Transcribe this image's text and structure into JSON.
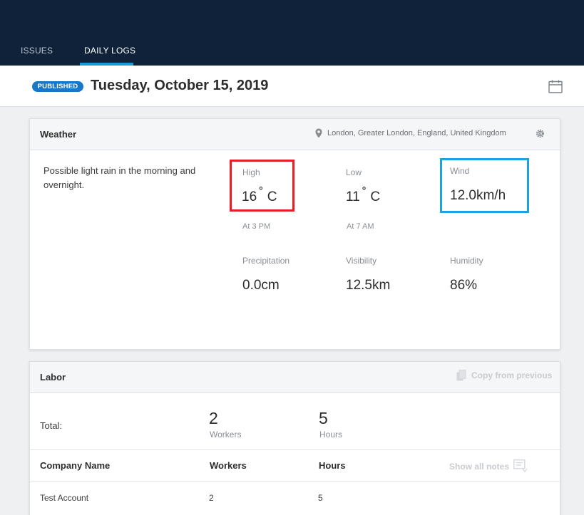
{
  "nav": {
    "tabs": [
      {
        "label": "ISSUES",
        "active": false
      },
      {
        "label": "DAILY LOGS",
        "active": true
      }
    ]
  },
  "header": {
    "status_badge": "PUBLISHED",
    "date": "Tuesday, October 15, 2019",
    "calendar_icon": "calendar-icon"
  },
  "weather": {
    "title": "Weather",
    "location": "London, Greater London, England, United Kingdom",
    "summary": "Possible light rain in the morning and overnight.",
    "high": {
      "label": "High",
      "value": "16",
      "degree": "°",
      "unit": "C",
      "time": "At 3 PM"
    },
    "low": {
      "label": "Low",
      "value": "11",
      "degree": "°",
      "unit": "C",
      "time": "At 7 AM"
    },
    "wind": {
      "label": "Wind",
      "value": "12.0km/h"
    },
    "precipitation": {
      "label": "Precipitation",
      "value": "0.0cm"
    },
    "visibility": {
      "label": "Visibility",
      "value": "12.5km"
    },
    "humidity": {
      "label": "Humidity",
      "value": "86%"
    }
  },
  "labor": {
    "title": "Labor",
    "copy_label": "Copy from previous",
    "total_label": "Total:",
    "workers_count": "2",
    "workers_label": "Workers",
    "hours_count": "5",
    "hours_label": "Hours",
    "columns": [
      "Company Name",
      "Workers",
      "Hours"
    ],
    "show_notes_label": "Show all notes",
    "rows": [
      {
        "company": "Test Account",
        "workers": "2",
        "hours": "5"
      }
    ]
  },
  "colors": {
    "topbar": "#0f2239",
    "accent": "#1a9bd7",
    "badge": "#1778c9",
    "highlight_red": "#e32024",
    "highlight_blue": "#1aa3dd"
  }
}
